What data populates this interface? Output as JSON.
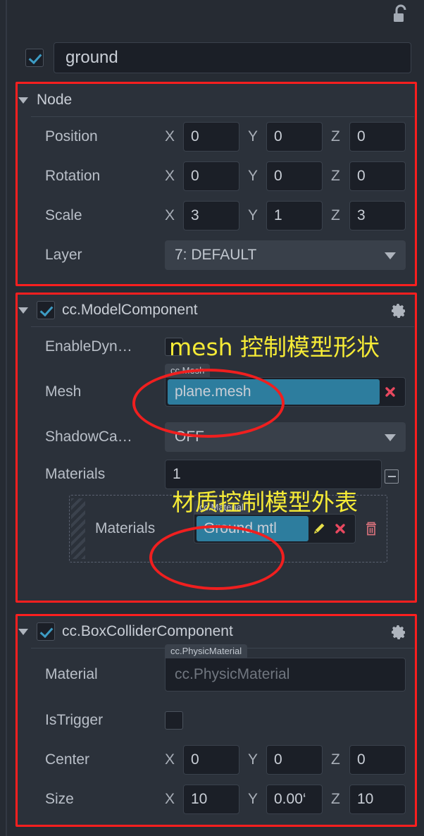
{
  "window": {
    "lock_icon": "unlocked-padlock-icon",
    "background": "#262b33"
  },
  "node_name": {
    "enabled": true,
    "value": "ground"
  },
  "sections": [
    {
      "id": "node",
      "title": "Node",
      "has_checkbox": false,
      "has_gear": false,
      "expanded": true
    },
    {
      "id": "model-component",
      "title": "cc.ModelComponent",
      "has_checkbox": true,
      "checked": true,
      "has_gear": true,
      "expanded": true
    },
    {
      "id": "box-collider-component",
      "title": "cc.BoxColliderComponent",
      "has_checkbox": true,
      "checked": true,
      "has_gear": true,
      "expanded": true
    }
  ],
  "node": {
    "position": {
      "label": "Position",
      "x": "0",
      "y": "0",
      "z": "0"
    },
    "rotation": {
      "label": "Rotation",
      "x": "0",
      "y": "0",
      "z": "0"
    },
    "scale": {
      "label": "Scale",
      "x": "3",
      "y": "1",
      "z": "3"
    },
    "layer": {
      "label": "Layer",
      "value": "7: DEFAULT"
    },
    "axes": {
      "x": "X",
      "y": "Y",
      "z": "Z"
    }
  },
  "model": {
    "enable_dynamic": {
      "label": "EnableDyn…",
      "checked": false
    },
    "mesh": {
      "label": "Mesh",
      "type_tab": "cc.Mesh",
      "value": "plane.mesh",
      "clear_icon": "x-icon"
    },
    "shadow_cast": {
      "label": "ShadowCa…",
      "value": "OFF"
    },
    "materials": {
      "label": "Materials",
      "count": "1",
      "collapse_icon": "minus-icon",
      "element": {
        "label": "Materials",
        "type_tab": "cc.Material",
        "value": "Ground.mtl",
        "edit_icon": "pencil-icon",
        "clear_icon": "x-icon",
        "delete_icon": "trash-icon"
      }
    }
  },
  "collider": {
    "material": {
      "label": "Material",
      "type_tab": "cc.PhysicMaterial",
      "placeholder": "cc.PhysicMaterial",
      "value": ""
    },
    "is_trigger": {
      "label": "IsTrigger",
      "checked": false
    },
    "center": {
      "label": "Center",
      "x": "0",
      "y": "0",
      "z": "0"
    },
    "size": {
      "label": "Size",
      "x": "10",
      "y": "0.00‘",
      "z": "10"
    },
    "axes": {
      "x": "X",
      "y": "Y",
      "z": "Z"
    }
  },
  "annotations": {
    "color_rect": "#fc1f1f",
    "color_ellipse": "#f01f1f",
    "color_text": "#f5ea36",
    "notes": [
      {
        "id": "mesh-note",
        "text": "mesh 控制模型形状"
      },
      {
        "id": "material-note",
        "text": "材质控制模型外表"
      }
    ]
  }
}
